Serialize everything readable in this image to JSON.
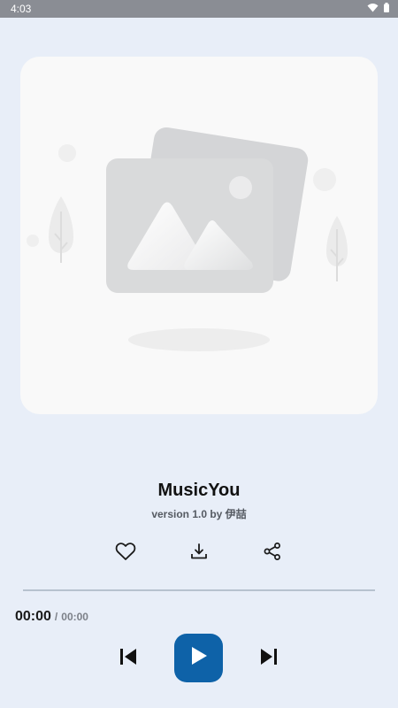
{
  "status_bar": {
    "time": "4:03",
    "icons": [
      "wifi-icon",
      "battery-icon"
    ]
  },
  "cover": {
    "placeholder_icon": "image-placeholder-icon"
  },
  "song": {
    "title": "MusicYou",
    "subtitle": "version 1.0 by 伊喆"
  },
  "actions": {
    "icons": [
      "heart-icon",
      "download-icon",
      "share-icon"
    ]
  },
  "progress": {
    "fraction": 0,
    "current_time": "00:00",
    "separator": "/",
    "total_time": "00:00"
  },
  "controls": {
    "icons": [
      "skip-previous-icon",
      "play-icon",
      "skip-next-icon"
    ]
  },
  "colors": {
    "background": "#e8eef8",
    "accent": "#0e62a8",
    "status_bar": "#8a8d94",
    "card": "#f9f9f9"
  }
}
